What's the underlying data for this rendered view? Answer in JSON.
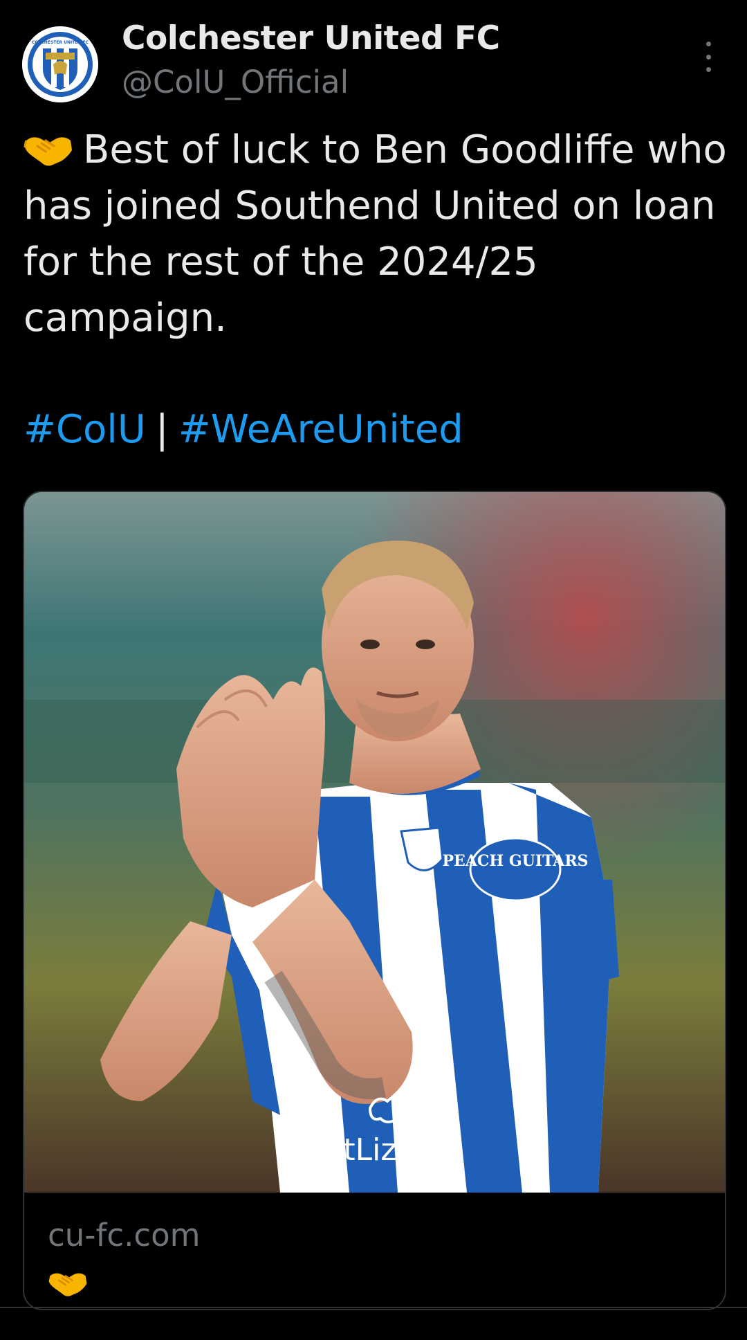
{
  "account": {
    "display_name": "Colchester United FC",
    "handle": "@ColU_Official",
    "avatar_badge_text": "COLCHESTER UNITED FC"
  },
  "tweet": {
    "emoji": "handshake",
    "text": "Best of luck to Ben Goodliffe who has joined Southend United on loan for the rest of the 2024/25 campaign.",
    "hashtags": [
      "#ColU",
      "#WeAreUnited"
    ],
    "hashtag_separator": "|"
  },
  "card": {
    "image_sponsor_logo": "HotLizard",
    "image_shirt_sponsor": "PEACH GUITARS",
    "domain": "cu-fc.com",
    "emoji": "handshake"
  },
  "icons": {
    "more": "more-vertical-icon",
    "emoji": "handshake-icon"
  },
  "colors": {
    "background": "#000000",
    "text_primary": "#e7e9ea",
    "text_secondary": "#71767b",
    "link": "#1d9bf0",
    "border": "#2f3336",
    "club_blue": "#1f5fb8"
  }
}
